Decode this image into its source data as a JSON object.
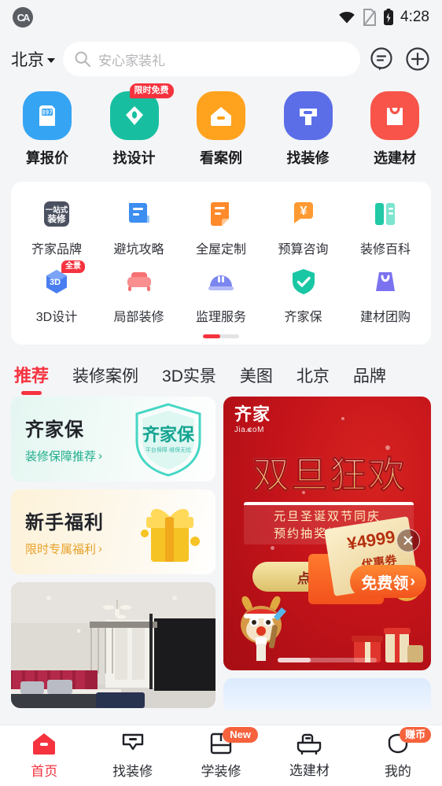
{
  "status_bar": {
    "app_badge": "CA",
    "time": "4:28",
    "icons": [
      "wifi-icon",
      "sim-card-icon",
      "battery-charging-icon"
    ]
  },
  "header": {
    "city": "北京",
    "search_placeholder": "安心家装礼",
    "chat_icon": "chat-bubble-icon",
    "add_icon": "plus-circle-icon"
  },
  "main_nav": [
    {
      "label": "算报价",
      "color": "#35a4f3",
      "icon": "calculator-icon",
      "icon_text": "897",
      "badge": ""
    },
    {
      "label": "找设计",
      "color": "#17bfa0",
      "icon": "pen-diamond-icon",
      "icon_text": "",
      "badge": "限时免费"
    },
    {
      "label": "看案例",
      "color": "#ffa21e",
      "icon": "house-icon",
      "icon_text": "",
      "badge": ""
    },
    {
      "label": "找装修",
      "color": "#5b6ee8",
      "icon": "hammer-icon",
      "icon_text": "",
      "badge": ""
    },
    {
      "label": "选建材",
      "color": "#f8544a",
      "icon": "shopping-bag-icon",
      "icon_text": "",
      "badge": ""
    }
  ],
  "grid": {
    "row1": [
      {
        "label": "齐家品牌",
        "icon": "one-stop-decoration-icon",
        "icon_text_top": "一站式",
        "icon_text_bottom": "装修",
        "color": "#4b5160",
        "badge": ""
      },
      {
        "label": "避坑攻略",
        "icon": "book-blue-icon",
        "color": "#3d8ef0",
        "badge": ""
      },
      {
        "label": "全屋定制",
        "icon": "document-orange-icon",
        "color": "#ff8a2b",
        "badge": ""
      },
      {
        "label": "预算咨询",
        "icon": "yuan-chat-icon",
        "color": "#ff9a32",
        "badge": ""
      },
      {
        "label": "装修百科",
        "icon": "open-book-green-icon",
        "color": "#21c9a6",
        "badge": ""
      }
    ],
    "row2": [
      {
        "label": "3D设计",
        "icon": "cube-3d-icon",
        "icon_text": "3D",
        "color": "#4a7ef0",
        "badge": "全景"
      },
      {
        "label": "局部装修",
        "icon": "sofa-icon",
        "color": "#f77171",
        "badge": ""
      },
      {
        "label": "监理服务",
        "icon": "helmet-icon",
        "color": "#7b86ef",
        "badge": ""
      },
      {
        "label": "齐家保",
        "icon": "shield-check-icon",
        "color": "#19c7a4",
        "badge": ""
      },
      {
        "label": "建材团购",
        "icon": "bag-purple-icon",
        "color": "#7b72f0",
        "badge": ""
      }
    ],
    "pager": {
      "pages": 2,
      "current": 1
    }
  },
  "tabs": {
    "items": [
      "推荐",
      "装修案例",
      "3D实景",
      "美图",
      "北京",
      "品牌"
    ],
    "active_index": 0,
    "accent": "#f5333f"
  },
  "feed": {
    "left": [
      {
        "type": "promo",
        "title": "齐家保",
        "subtitle": "装修保障推荐",
        "arrow": "›",
        "theme": "teal",
        "art": "shield-qijiabao-icon",
        "art_text": "齐家保",
        "art_sub": "平台保障·维保无忧"
      },
      {
        "type": "promo",
        "title": "新手福利",
        "subtitle": "限时专属福利",
        "arrow": "›",
        "theme": "gold",
        "art": "gift-box-icon"
      },
      {
        "type": "photo",
        "alt": "bedroom-interior-photo"
      }
    ],
    "right_banner": {
      "logo_cn": "齐家",
      "logo_en": "Jia.coM",
      "title": "双旦狂欢",
      "sub_line1": "元旦圣诞双节同庆",
      "sub_line2": "预约抽奖惊喜不断",
      "cta": "点击参与",
      "coupon_amount": "¥4999",
      "coupon_label": "优惠券",
      "free_button": "免费领",
      "free_button_arrow": "›",
      "close_icon": "close-x-icon",
      "mascot": "reindeer-mascot-icon",
      "gifts": "gift-pile-icon",
      "pager": {
        "pages": 3,
        "current": 1
      }
    }
  },
  "tabbar": {
    "items": [
      {
        "label": "首页",
        "icon": "home-icon",
        "active": true,
        "badge": ""
      },
      {
        "label": "找装修",
        "icon": "hammer-outline-icon",
        "active": false,
        "badge": ""
      },
      {
        "label": "学装修",
        "icon": "book-outline-icon",
        "active": false,
        "badge": "New"
      },
      {
        "label": "选建材",
        "icon": "bathtub-outline-icon",
        "active": false,
        "badge": ""
      },
      {
        "label": "我的",
        "icon": "person-outline-icon",
        "active": false,
        "badge": "赚币"
      }
    ],
    "active_color": "#f5333f"
  }
}
